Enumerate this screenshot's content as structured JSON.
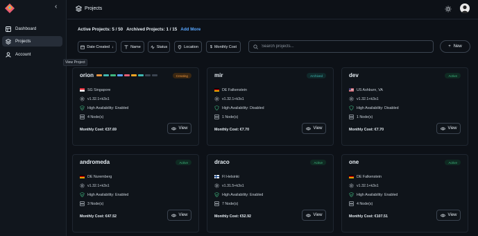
{
  "sidebar": {
    "items": [
      {
        "label": "Dashboard"
      },
      {
        "label": "Projects"
      },
      {
        "label": "Account"
      }
    ],
    "tooltip": "View Project"
  },
  "header": {
    "title": "Projects"
  },
  "summary": {
    "active": "Active Projects: 5 / 50",
    "archived": "Archived Projects: 1 / 15",
    "add_more": "Add More"
  },
  "filters": {
    "date_created": "Date Created",
    "name": "Name",
    "status": "Status",
    "location": "Location",
    "monthly_cost": "Monthly Cost"
  },
  "search": {
    "placeholder": "Search projects..."
  },
  "new_button": "New",
  "colors": {
    "creating": "#e8923c",
    "active": "#3fb87f",
    "archived": "#3fb7b0",
    "accent": "#58a6ff"
  },
  "projects": [
    {
      "name": "orion",
      "status": "Creating",
      "location": "SG Singapore",
      "flag": "sg",
      "version": "v1.32.1+k3s1",
      "ha": "High Availability: Enabled",
      "ha_enabled": true,
      "nodes": "4 Node(s)",
      "cost": "Monthly Cost: €37.69",
      "view": "View",
      "progress_segments": 9
    },
    {
      "name": "mir",
      "status": "Archived",
      "location": "DE Falkenstein",
      "flag": "de",
      "version": "v1.32.1+k3s1",
      "ha": "High Availability: Disabled",
      "ha_enabled": false,
      "nodes": "1 Node(s)",
      "cost": "Monthly Cost: €7.70",
      "view": "View"
    },
    {
      "name": "dev",
      "status": "Active",
      "location": "US Ashburn, VA",
      "flag": "us",
      "version": "v1.32.1+k3s1",
      "ha": "High Availability: Disabled",
      "ha_enabled": false,
      "nodes": "1 Node(s)",
      "cost": "Monthly Cost: €7.70",
      "view": "View"
    },
    {
      "name": "andromeda",
      "status": "Active",
      "location": "DE Nuremberg",
      "flag": "de",
      "version": "v1.32.1+k3s1",
      "ha": "High Availability: Enabled",
      "ha_enabled": true,
      "nodes": "3 Node(s)",
      "cost": "Monthly Cost: €47.52",
      "view": "View"
    },
    {
      "name": "draco",
      "status": "Active",
      "location": "FI Helsinki",
      "flag": "fi",
      "version": "v1.31.5+k3s1",
      "ha": "High Availability: Enabled",
      "ha_enabled": true,
      "nodes": "7 Node(s)",
      "cost": "Monthly Cost: €52.92",
      "view": "View"
    },
    {
      "name": "one",
      "status": "Active",
      "location": "DE Falkenstein",
      "flag": "de",
      "version": "v1.32.1+k3s1",
      "ha": "High Availability: Enabled",
      "ha_enabled": true,
      "nodes": "4 Node(s)",
      "cost": "Monthly Cost: €107.51",
      "view": "View"
    }
  ]
}
